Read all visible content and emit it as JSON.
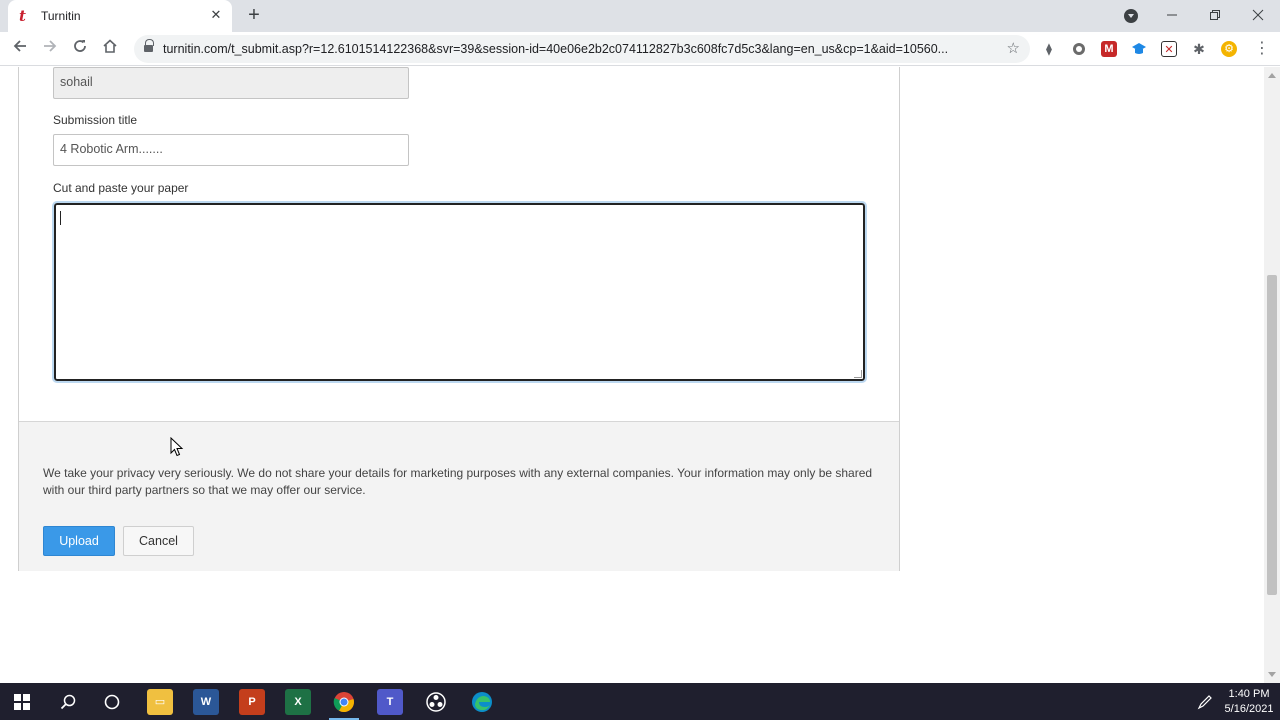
{
  "browser": {
    "tab_title": "Turnitin",
    "tab_close": "✕",
    "new_tab": "+",
    "url": "turnitin.com/t_submit.asp?r=12.6101514122368&svr=39&session-id=40e06e2b2c074112827b3c608fc7d5c3&lang=en_us&cp=1&aid=10560...",
    "favicon_letter": "t"
  },
  "form": {
    "name_value": "sohail",
    "submission_title_label": "Submission title",
    "submission_title_value": "4 Robotic Arm.......",
    "paper_label": "Cut and paste your paper",
    "paper_value": "",
    "privacy_text": "We take your privacy very seriously. We do not share your details for marketing purposes with any external companies. Your information may only be shared with our third party partners so that we may offer our service.",
    "upload_label": "Upload",
    "cancel_label": "Cancel"
  },
  "taskbar": {
    "time": "1:40 PM",
    "date": "5/16/2021"
  },
  "colors": {
    "upload_button": "#3a99e8",
    "taskbar": "#1f1f2e",
    "tab_strip": "#dee1e6"
  }
}
